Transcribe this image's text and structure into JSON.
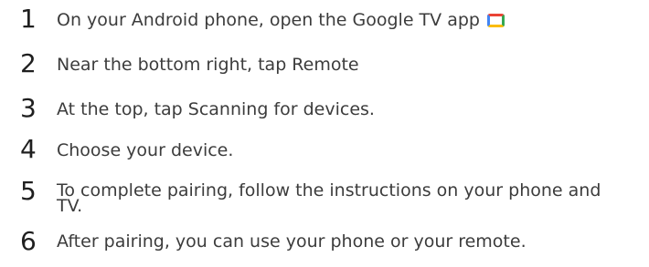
{
  "steps": [
    {
      "number": "1",
      "text": "On your Android phone, open the Google TV app",
      "icon": "google-tv-app-icon"
    },
    {
      "number": "2",
      "text": "Near the bottom right, tap Remote"
    },
    {
      "number": "3",
      "text": "At the top, tap Scanning for devices."
    },
    {
      "number": "4",
      "text": "Choose your device."
    },
    {
      "number": "5",
      "text": "To complete pairing, follow the instructions on your phone and TV."
    },
    {
      "number": "6",
      "text": "After pairing, you can use your phone or your remote."
    }
  ],
  "colors": {
    "number": "#1f1f1f",
    "text": "#3c3c3c",
    "icon_red": "#ea4335",
    "icon_blue": "#4285f4",
    "icon_green": "#34a853",
    "icon_yellow": "#fbbc04"
  }
}
